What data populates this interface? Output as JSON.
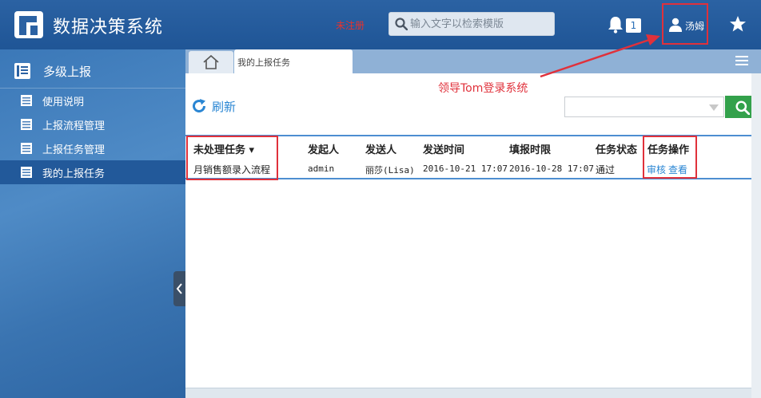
{
  "header": {
    "app_title": "数据决策系统",
    "unregistered": "未注册",
    "search_placeholder": "输入文字以检索模版",
    "notification_count": "1",
    "user_name": "汤姆"
  },
  "sidebar": {
    "section_title": "多级上报",
    "items": [
      {
        "label": "使用说明",
        "active": false
      },
      {
        "label": "上报流程管理",
        "active": false
      },
      {
        "label": "上报任务管理",
        "active": false
      },
      {
        "label": "我的上报任务",
        "active": true
      }
    ]
  },
  "tabs": {
    "active_tab": "我的上报任务"
  },
  "annotation": "领导Tom登录系统",
  "toolbar": {
    "refresh_label": "刷新",
    "filter_value": ""
  },
  "table": {
    "columns": [
      "未处理任务",
      "发起人",
      "发送人",
      "发送时间",
      "填报时限",
      "任务状态",
      "任务操作"
    ],
    "rows": [
      {
        "task": "月销售额录入流程",
        "initiator": "admin",
        "sender": "丽莎(Lisa)",
        "send_time": "2016-10-21 17:07",
        "deadline": "2016-10-28 17:07",
        "status": "通过",
        "action_review": "审核",
        "action_view": "查看"
      }
    ]
  },
  "colors": {
    "header_bg": "#2b62a3",
    "sidebar_active": "#22599a",
    "annotation_red": "#e0313b",
    "link_blue": "#2a86d3",
    "search_green": "#33a14b"
  }
}
